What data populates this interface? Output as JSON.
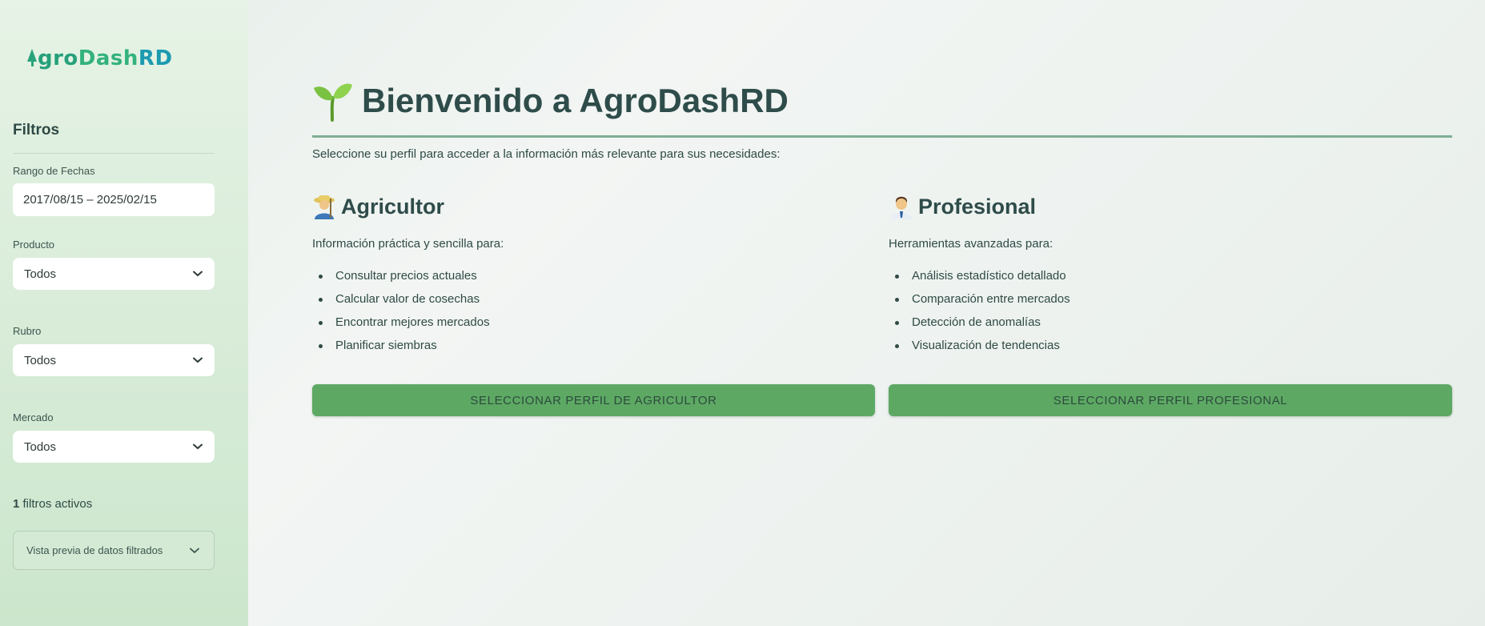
{
  "brand": {
    "logo": "AgroDashRD"
  },
  "sidebar": {
    "filters_title": "Filtros",
    "date_range": {
      "label": "Rango de Fechas",
      "value": "2017/08/15 – 2025/02/15"
    },
    "product": {
      "label": "Producto",
      "value": "Todos"
    },
    "category": {
      "label": "Rubro",
      "value": "Todos"
    },
    "market": {
      "label": "Mercado",
      "value": "Todos"
    },
    "active_filters": {
      "count": "1",
      "text": "filtros activos"
    },
    "preview_expander": "Vista previa de datos filtrados"
  },
  "main": {
    "title": "Bienvenido a AgroDashRD",
    "subtitle": "Seleccione su perfil para acceder a la información más relevante para sus necesidades:",
    "farmer": {
      "title": "Agricultor",
      "description": "Información práctica y sencilla para:",
      "items": [
        "Consultar precios actuales",
        "Calcular valor de cosechas",
        "Encontrar mejores mercados",
        "Planificar siembras"
      ],
      "button": "SELECCIONAR PERFIL DE AGRICULTOR"
    },
    "professional": {
      "title": "Profesional",
      "description": "Herramientas avanzadas para:",
      "items": [
        "Análisis estadístico detallado",
        "Comparación entre mercados",
        "Detección de anomalías",
        "Visualización de tendencias"
      ],
      "button": "SELECCIONAR PERFIL PROFESIONAL"
    }
  },
  "colors": {
    "accent_green": "#5da964",
    "title_text": "#2e4c4a",
    "rule": "#7fae94"
  }
}
